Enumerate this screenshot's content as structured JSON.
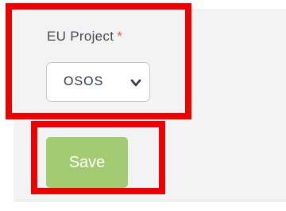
{
  "form": {
    "field_label": "EU Project",
    "required_marker": "*",
    "select_value": "OSOS",
    "save_label": "Save"
  },
  "icons": {
    "dropdown": "chevron-down-icon"
  },
  "colors": {
    "save_button": "#a3cc72",
    "required_marker": "#e05a4c",
    "highlight": "#ee0000",
    "panel_background": "#f3f3f3"
  }
}
